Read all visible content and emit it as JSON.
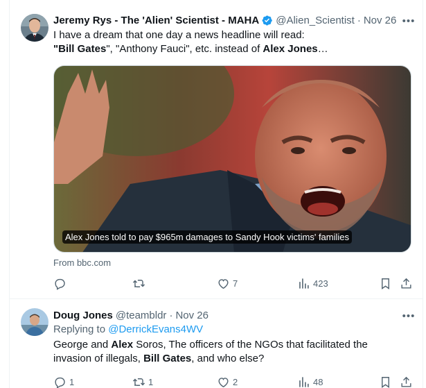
{
  "tweet1": {
    "author_name": "Jeremy Rys - The 'Alien' Scientist - MAHA",
    "handle": "@Alien_Scientist",
    "separator": "·",
    "date": "Nov 26",
    "text_line1": "I have a dream that one day a news headline will read:",
    "text_q1": "\"",
    "text_bold1": "Bill Gates",
    "text_mid": "\", \"Anthony Fauci\", etc. instead of ",
    "text_bold2": "Alex Jones",
    "text_ellipsis": "…",
    "card_caption": "Alex Jones told to pay $965m damages to Sandy Hook victims' families",
    "card_source": "From bbc.com",
    "actions": {
      "reply_count": "",
      "retweet_count": "",
      "like_count": "7",
      "view_count": "423"
    }
  },
  "tweet2": {
    "author_name": "Doug Jones",
    "handle": "@teambldr",
    "separator": "·",
    "date": "Nov 26",
    "replying_prefix": "Replying to ",
    "replying_handle": "@DerrickEvans4WV",
    "t1": "George and ",
    "t2": "Alex",
    "t3": " Soros, The officers of the NGOs that facilitated the",
    "t4": "invasion of illegals, ",
    "t5": "Bill Gates",
    "t6": ", and who else?",
    "actions": {
      "reply_count": "1",
      "retweet_count": "1",
      "like_count": "2",
      "view_count": "48"
    }
  },
  "icons": {
    "more": "more-icon",
    "reply": "reply-icon",
    "retweet": "retweet-icon",
    "like": "heart-icon",
    "views": "views-icon",
    "bookmark": "bookmark-icon",
    "share": "share-icon",
    "verified": "verified-badge-icon"
  },
  "colors": {
    "text": "#0f1419",
    "secondary": "#536471",
    "link": "#1d9bf0",
    "verified": "#1d9bf0",
    "border": "#eff3f4"
  }
}
